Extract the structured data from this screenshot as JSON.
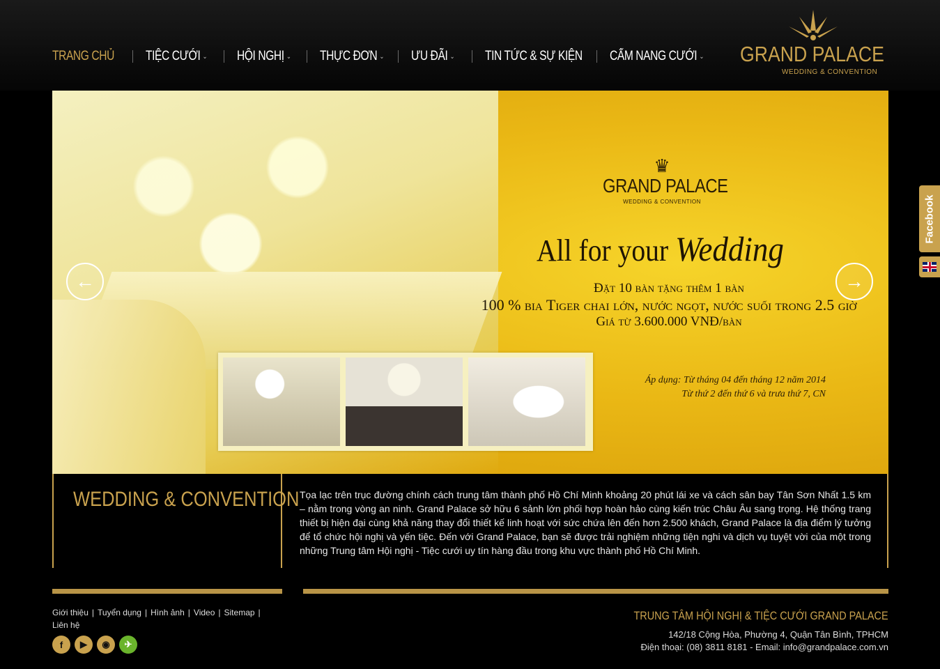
{
  "nav": {
    "items": [
      {
        "label": "TRANG CHỦ",
        "caret": ""
      },
      {
        "label": "TIỆC CƯỚI",
        "caret": "⌄"
      },
      {
        "label": "HỘI NGHỊ",
        "caret": "⌄"
      },
      {
        "label": "THỰC ĐƠN",
        "caret": "⌄"
      },
      {
        "label": "ƯU ĐÃI",
        "caret": "⌄"
      },
      {
        "label": "TIN TỨC & SỰ KIỆN",
        "caret": ""
      },
      {
        "label": "CẨM NANG CƯỚI",
        "caret": "⌄"
      }
    ]
  },
  "logo": {
    "title": "GRAND PALACE",
    "subtitle": "WEDDING & CONVENTION"
  },
  "banner": {
    "logo_title": "GRAND PALACE",
    "logo_subtitle": "WEDDING & CONVENTION",
    "tagline_plain": "All for your",
    "tagline_script": "Wedding",
    "promo_line1": "Đặt 10 bàn tặng thêm 1 bàn",
    "promo_line2": "100 % bia Tiger chai lớn, nước ngọt, nước suối trong 2.5 giờ",
    "promo_line3": "Giá từ 3.600.000 VNĐ/bàn",
    "apply_line1": "Áp dụng: Từ tháng 04 đến tháng 12 năm 2014",
    "apply_line2": "Từ thứ 2 đến thứ 6 và trưa thứ 7, CN",
    "prev_icon": "arrow-left-icon",
    "next_icon": "arrow-right-icon"
  },
  "info": {
    "title": "WEDDING & CONVENTION",
    "text": "Tọa lạc trên trục đường chính cách trung tâm thành phố Hồ Chí Minh khoảng 20 phút lái xe và cách sân bay Tân Sơn Nhất 1.5 km – nằm trong vòng an ninh. Grand Palace sở hữu 6 sảnh lớn phối hợp hoàn hảo cùng kiến trúc Châu Âu sang trọng. Hệ thống trang thiết bị hiện đại cùng khả năng thay đổi thiết kế linh hoạt với sức chứa lên đến hơn 2.500 khách, Grand Palace là địa điểm lý tưởng để tổ chức hội nghị và yến tiệc. Đến với Grand Palace, bạn sẽ được trải nghiệm những tiện nghi và dịch vụ tuyệt vời của một trong những Trung tâm Hội nghị - Tiệc cưới uy tín hàng đầu trong khu vực thành phố Hồ Chí Minh."
  },
  "footer": {
    "links": [
      "Giới thiệu",
      "Tuyển dụng",
      "Hình ảnh",
      "Video",
      "Sitemap",
      "Liên hệ"
    ],
    "socials": [
      {
        "icon": "facebook-icon",
        "glyph": "f"
      },
      {
        "icon": "youtube-icon",
        "glyph": "▶"
      },
      {
        "icon": "map-pin-icon",
        "glyph": "◉"
      },
      {
        "icon": "tripadvisor-icon",
        "glyph": "✈"
      }
    ],
    "company": "TRUNG TÂM HỘI NGHỊ & TIỆC CƯỚI GRAND PALACE",
    "address": "142/18 Cộng Hòa, Phường 4, Quận Tân Bình, TPHCM",
    "contact": "Điện thoại: (08) 3811 8181 - Email: info@grandpalace.com.vn"
  },
  "side": {
    "facebook_label": "Facebook",
    "lang_icon": "uk-flag-icon"
  },
  "colors": {
    "accent": "#c9a24e",
    "background": "#000000",
    "banner_yellow": "#eab815"
  }
}
